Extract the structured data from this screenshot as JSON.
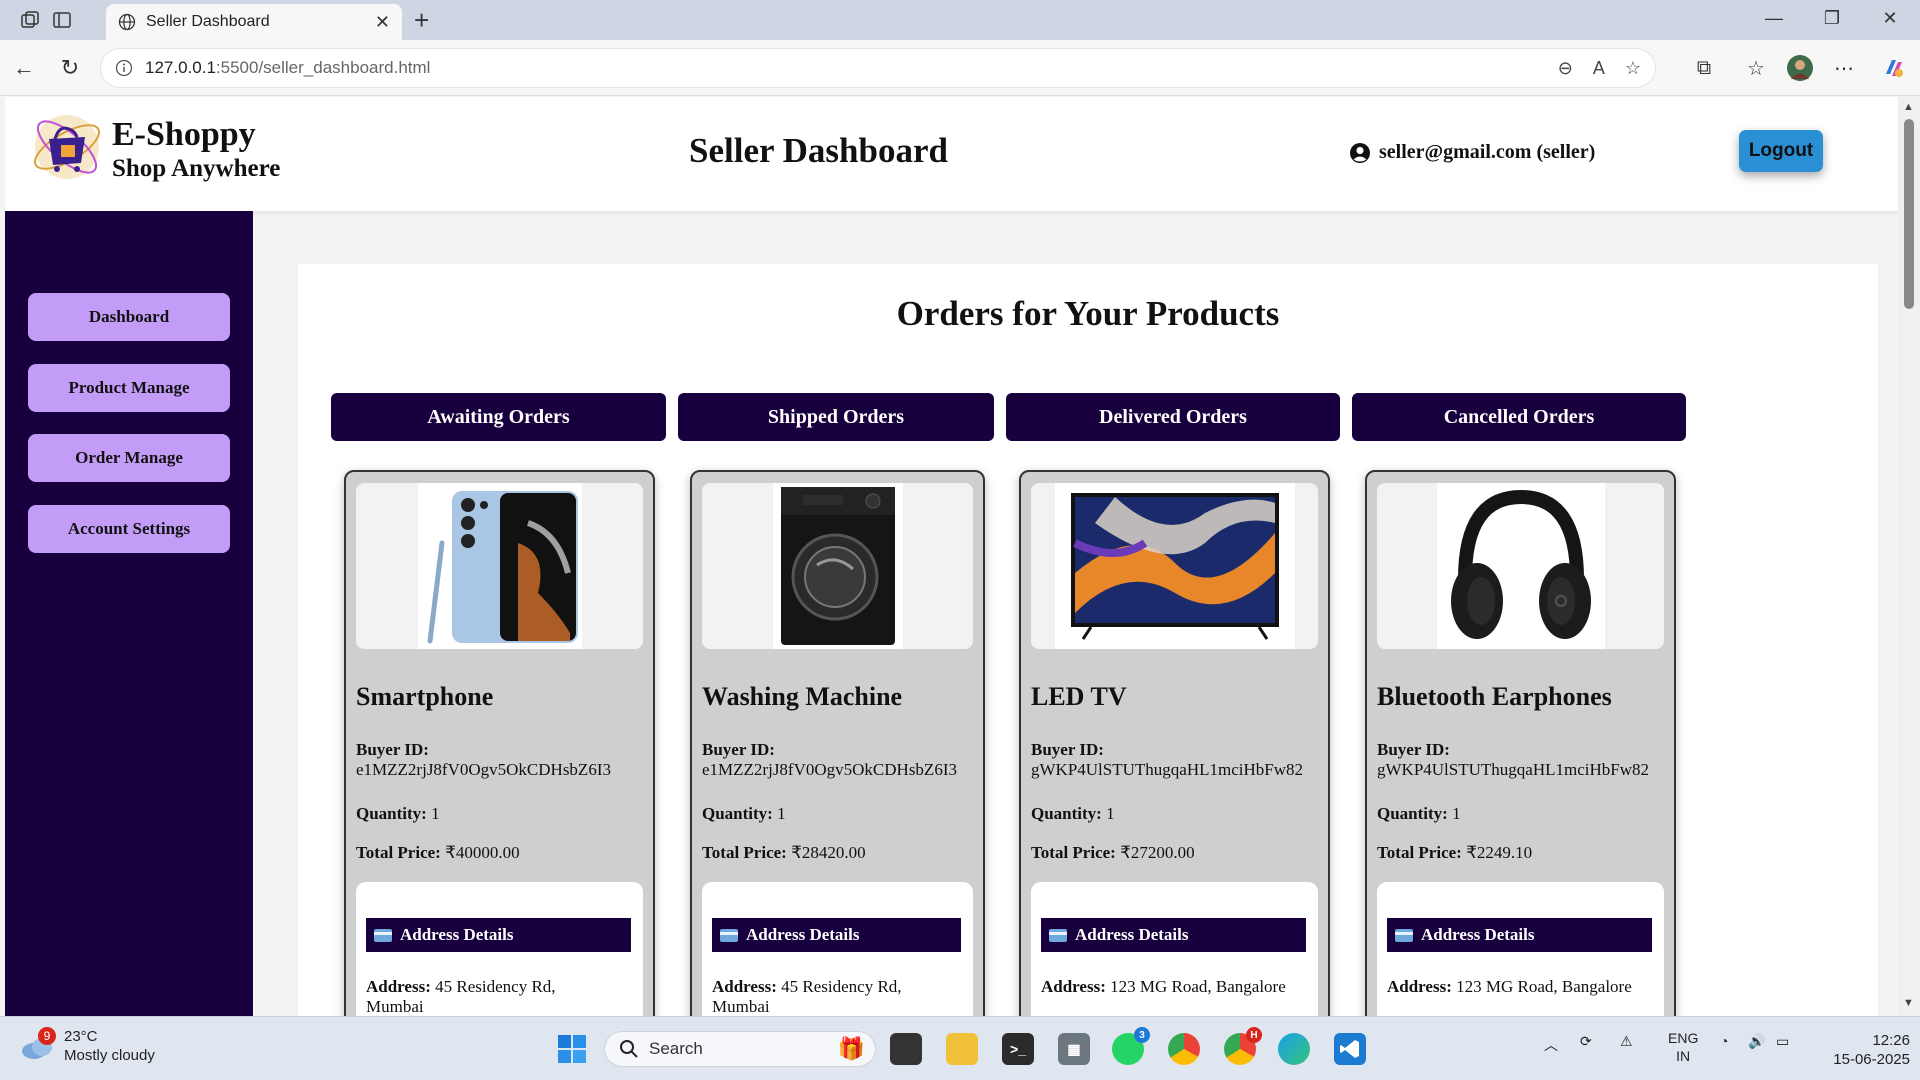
{
  "browser": {
    "tab_title": "Seller Dashboard",
    "url_host": "127.0.0.1",
    "url_rest": ":5500/seller_dashboard.html"
  },
  "header": {
    "brand_name": "E-Shoppy",
    "brand_tagline": "Shop Anywhere",
    "page_title": "Seller Dashboard",
    "user_label": "seller@gmail.com (seller)",
    "logout_label": "Logout"
  },
  "sidebar": {
    "items": [
      {
        "label": "Dashboard"
      },
      {
        "label": "Product Manage"
      },
      {
        "label": "Order Manage"
      },
      {
        "label": "Account Settings"
      }
    ]
  },
  "main": {
    "title": "Orders for Your Products",
    "filters": [
      {
        "label": "Awaiting Orders"
      },
      {
        "label": "Shipped Orders"
      },
      {
        "label": "Delivered Orders"
      },
      {
        "label": "Cancelled Orders"
      }
    ],
    "buyer_label": "Buyer ID:",
    "quantity_label": "Quantity:",
    "total_label": "Total Price:",
    "address_header": "Address Details",
    "address_label": "Address:",
    "orders": [
      {
        "name": "Smartphone",
        "buyer_id": "e1MZZ2rjJ8fV0Ogv5OkCDHsbZ6I3",
        "quantity": "1",
        "total": "₹40000.00",
        "address": "45 Residency Rd,",
        "address_line2": "Mumbai"
      },
      {
        "name": "Washing Machine",
        "buyer_id": "e1MZZ2rjJ8fV0Ogv5OkCDHsbZ6I3",
        "quantity": "1",
        "total": "₹28420.00",
        "address": "45 Residency Rd,",
        "address_line2": "Mumbai"
      },
      {
        "name": "LED TV",
        "buyer_id": "gWKP4UlSTUThugqaHL1mciHbFw82",
        "quantity": "1",
        "total": "₹27200.00",
        "address": "123 MG Road, Bangalore",
        "address_line2": ""
      },
      {
        "name": "Bluetooth Earphones",
        "buyer_id": "gWKP4UlSTUThugqaHL1mciHbFw82",
        "quantity": "1",
        "total": "₹2249.10",
        "address": "123 MG Road, Bangalore",
        "address_line2": ""
      }
    ]
  },
  "taskbar": {
    "weather_badge": "9",
    "temperature": "23°C",
    "condition": "Mostly cloudy",
    "search_placeholder": "Search",
    "whatsapp_badge": "3",
    "chrome_badge": "H",
    "lang_line1": "ENG",
    "lang_line2": "IN",
    "time": "12:26",
    "date": "15-06-2025"
  },
  "colors": {
    "sidebar_bg": "#17003d",
    "sidebar_button": "#c39cf7",
    "logout": "#2b8fd6",
    "card_bg": "#cfcfcf"
  }
}
